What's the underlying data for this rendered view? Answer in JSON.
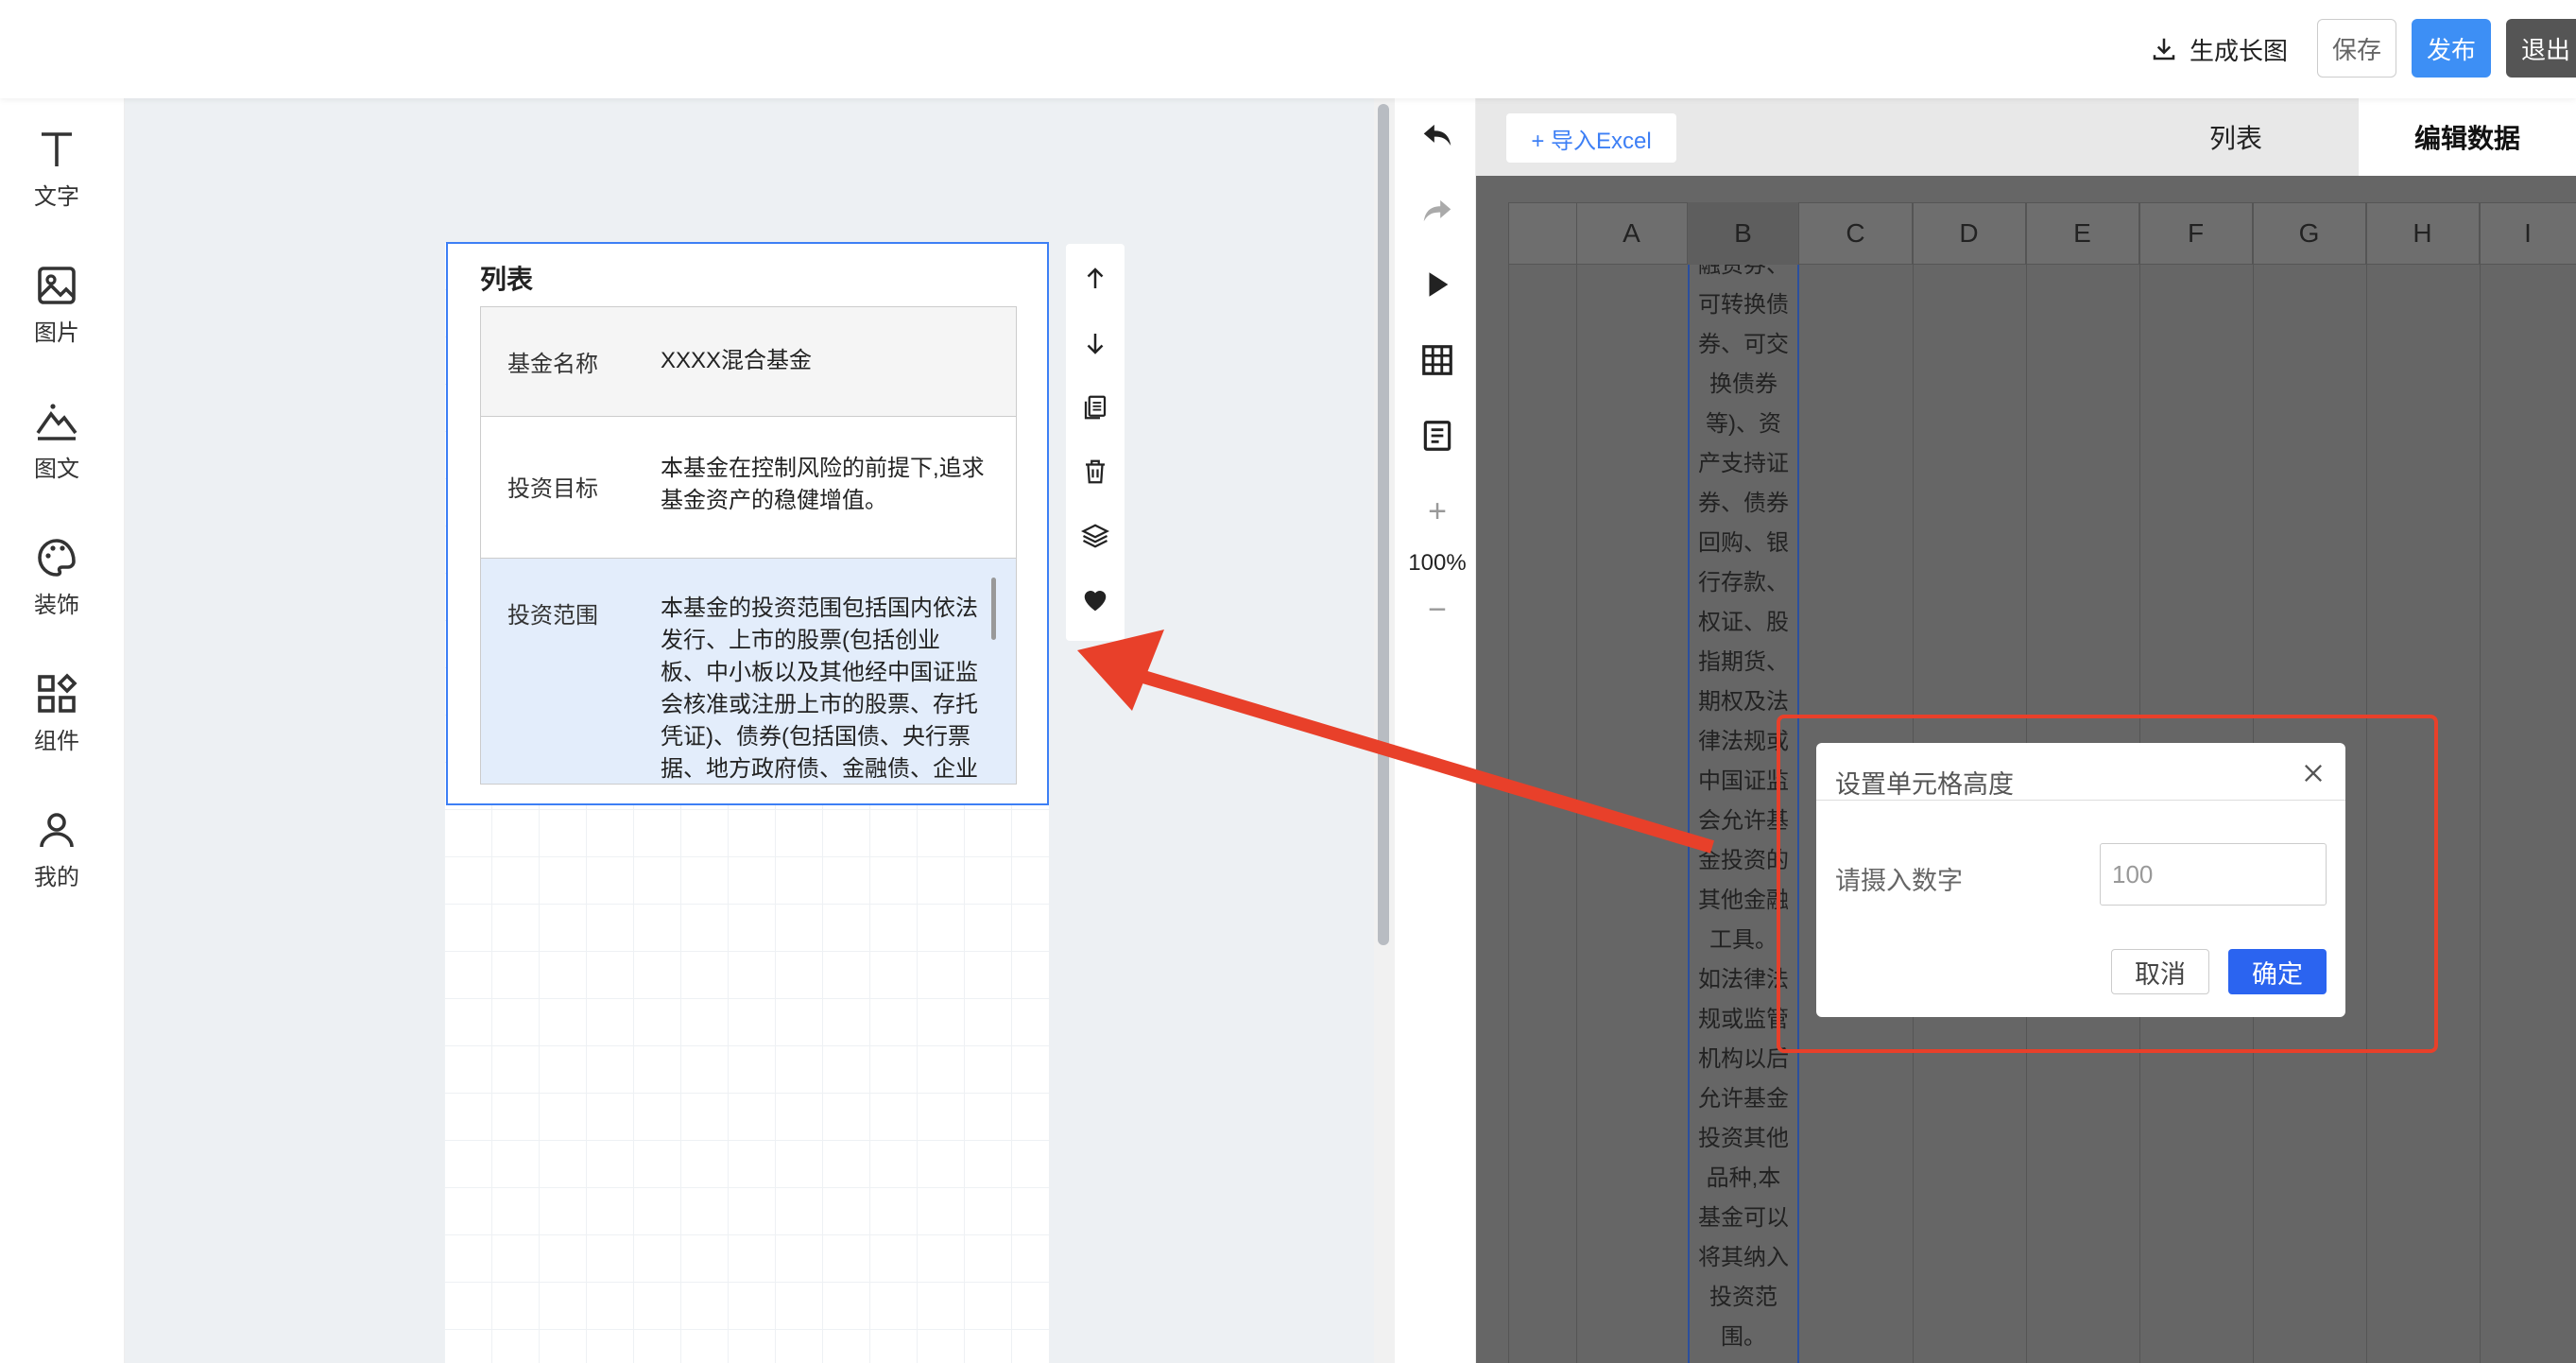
{
  "topbar": {
    "download_label": "生成长图",
    "save_label": "保存",
    "publish_label": "发布",
    "exit_label": "退出"
  },
  "sidebar": {
    "items": [
      {
        "label": "文字",
        "icon": "text-icon"
      },
      {
        "label": "图片",
        "icon": "image-icon"
      },
      {
        "label": "图文",
        "icon": "mountain-icon"
      },
      {
        "label": "装饰",
        "icon": "palette-icon"
      },
      {
        "label": "组件",
        "icon": "components-icon"
      },
      {
        "label": "我的",
        "icon": "user-icon"
      }
    ]
  },
  "widget": {
    "title": "列表",
    "rows": [
      {
        "label": "基金名称",
        "value": "XXXX混合基金"
      },
      {
        "label": "投资目标",
        "value_lines": [
          "本基金在控制风险的前提下,追求",
          "基金资产的稳健增值。"
        ]
      },
      {
        "label": "投资范围",
        "value_lines": [
          "本基金的投资范围包括国内依法",
          "发行、上市的股票(包括创业",
          "板、中小板以及其他经中国证监",
          "会核准或注册上市的股票、存托",
          "凭证)、债券(包括国债、央行票",
          "据、地方政府债、金融债、企业"
        ]
      }
    ]
  },
  "toolbox": {
    "icons": [
      "arrow-up-icon",
      "arrow-down-icon",
      "copy-icon",
      "trash-icon",
      "layers-icon",
      "heart-icon"
    ]
  },
  "editor_tools": {
    "zoom": "100%",
    "zoom_in": "+",
    "zoom_out": "−"
  },
  "right_panel": {
    "import_label": "+ 导入Excel",
    "tabs": [
      "列表",
      "编辑数据"
    ],
    "active_tab": "编辑数据",
    "columns": [
      "A",
      "B",
      "C",
      "D",
      "E",
      "F",
      "G",
      "H",
      "I"
    ],
    "cell_b_lines": [
      "融资券、",
      "可转换债",
      "券、可交",
      "换债券",
      "等)、资",
      "产支持证",
      "券、债券",
      "回购、银",
      "行存款、",
      "权证、股",
      "指期货、",
      "期权及法",
      "律法规或",
      "中国证监",
      "会允许基",
      "金投资的",
      "其他金融",
      "工具。",
      "如法律法",
      "规或监管",
      "机构以后",
      "允许基金",
      "投资其他",
      "品种,本",
      "基金可以",
      "将其纳入",
      "投资范",
      "围。"
    ]
  },
  "dialog": {
    "title": "设置单元格高度",
    "field_label": "请摄入数字",
    "field_value": "100",
    "cancel_label": "取消",
    "confirm_label": "确定"
  },
  "colors": {
    "accent": "#3d7ff5",
    "confirm": "#2b64f0",
    "annotation": "#e8402a",
    "selected_row": "#e3edfb"
  }
}
